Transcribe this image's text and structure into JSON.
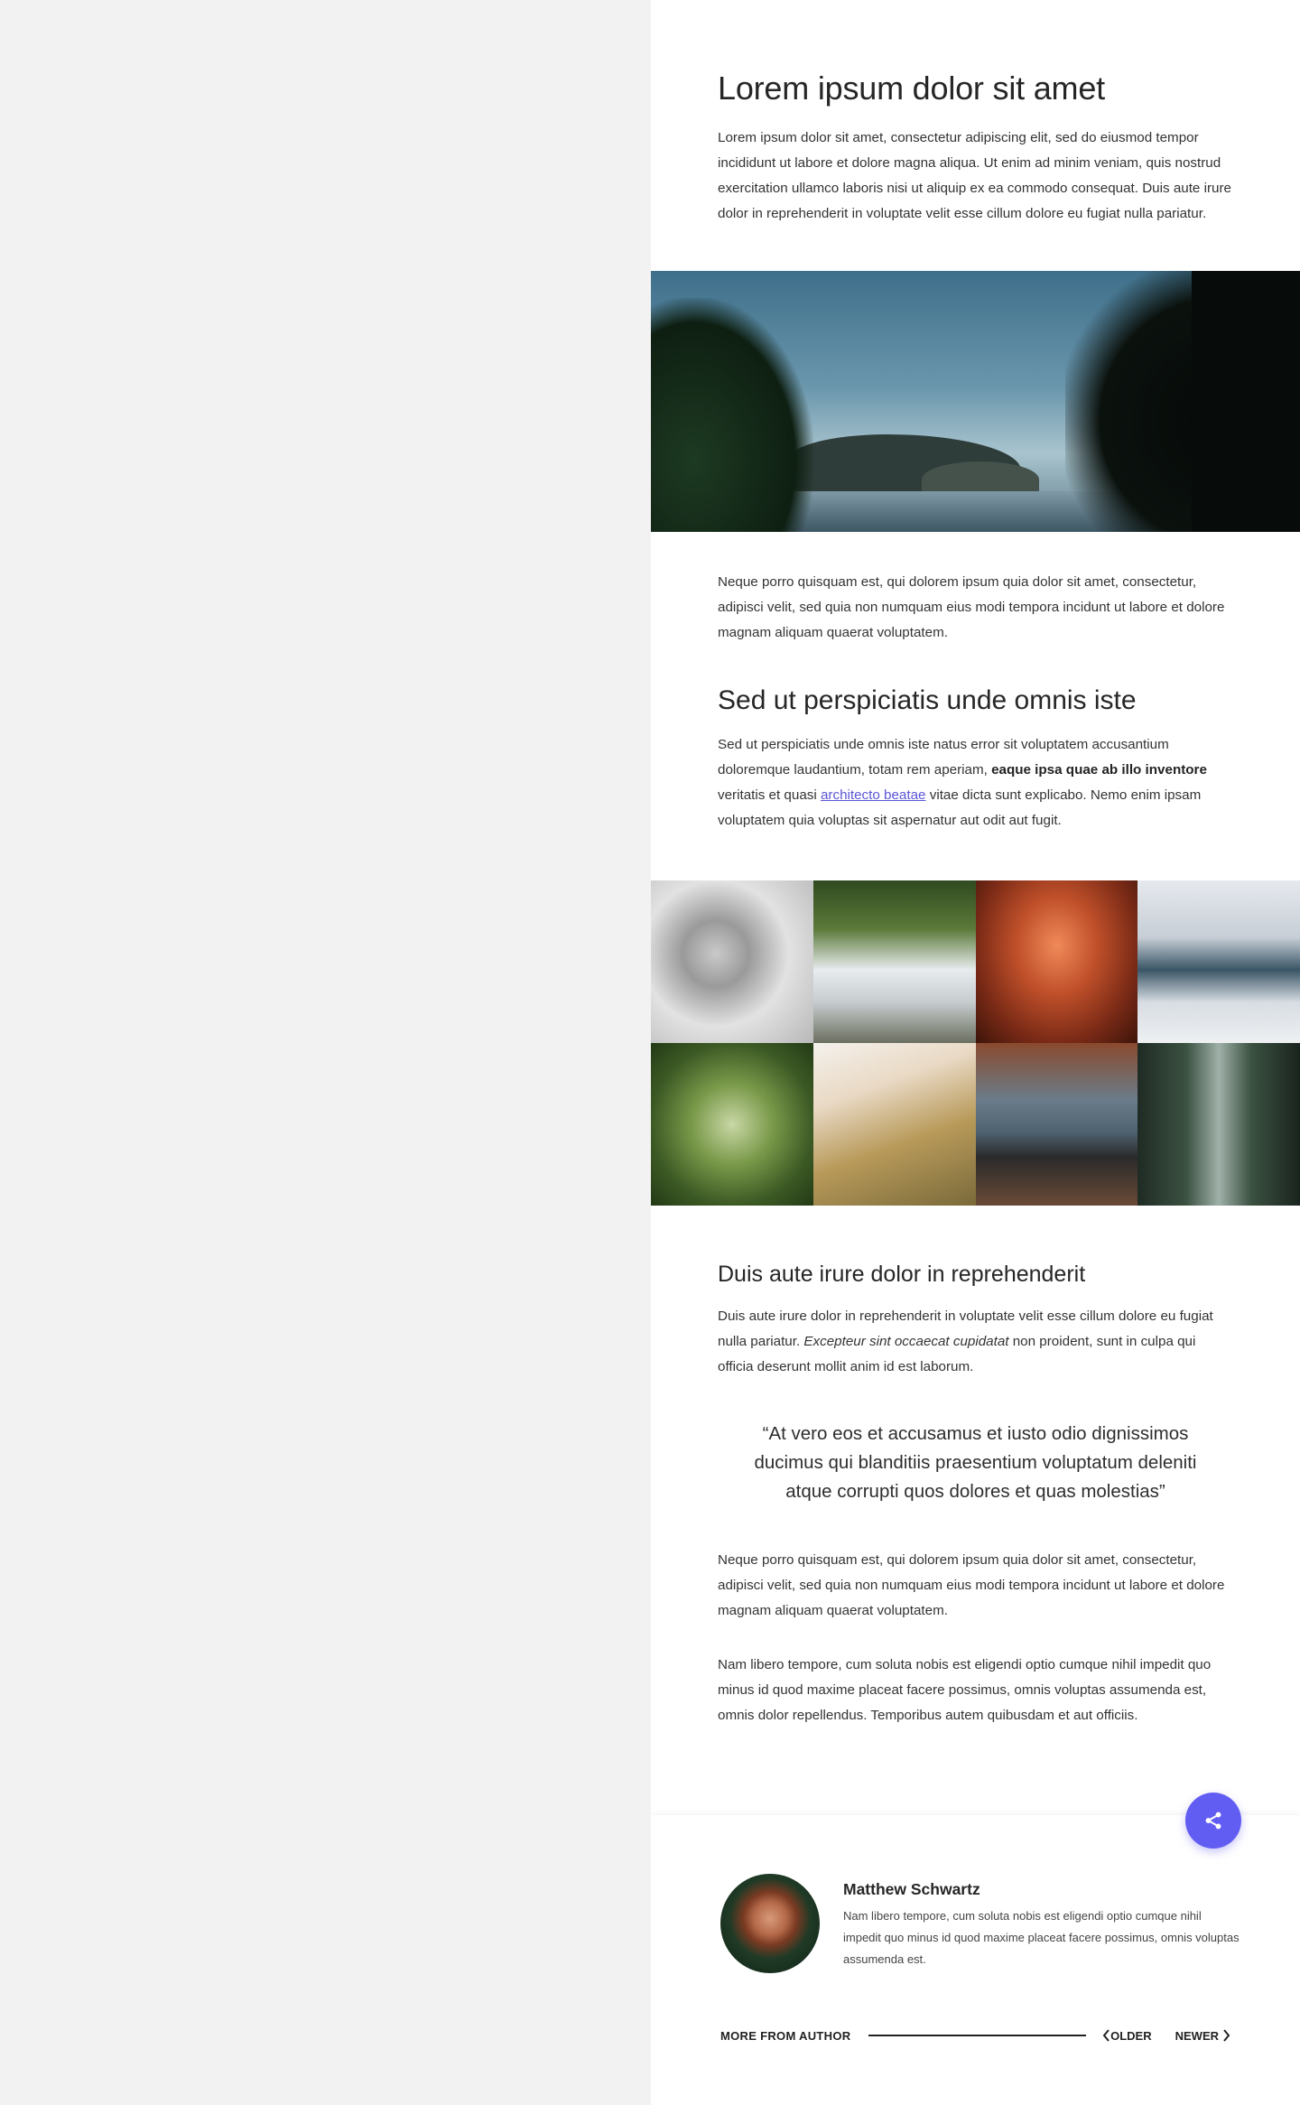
{
  "article": {
    "title": "Lorem ipsum dolor sit amet",
    "intro": "Lorem ipsum dolor sit amet, consectetur adipiscing elit, sed do eiusmod tempor incididunt ut labore et dolore magna aliqua. Ut enim ad minim veniam, quis nostrud exercitation ullamco laboris nisi ut aliquip ex ea commodo consequat. Duis aute irure dolor in reprehenderit in voluptate velit esse cillum dolore eu fugiat nulla pariatur.",
    "paragraph2": "Neque porro quisquam est, qui dolorem ipsum quia dolor sit amet, consectetur, adipisci velit, sed quia non numquam eius modi tempora incidunt ut labore et dolore magnam aliquam quaerat voluptatem.",
    "heading2": "Sed ut perspiciatis unde omnis iste",
    "p3_a": "Sed ut perspiciatis unde omnis iste natus error sit voluptatem accusantium doloremque laudantium, totam rem aperiam, ",
    "p3_bold": "eaque ipsa quae ab illo inventore",
    "p3_b": " veritatis et quasi ",
    "p3_link": "architecto beatae",
    "p3_c": " vitae dicta sunt explicabo. Nemo enim ipsam voluptatem quia voluptas sit aspernatur aut odit aut fugit.",
    "heading3": "Duis aute irure dolor in reprehenderit",
    "p4_a": "Duis aute irure dolor in reprehenderit in voluptate velit esse cillum dolore eu fugiat nulla pariatur. ",
    "p4_em": "Excepteur sint occaecat cupidatat",
    "p4_b": " non proident, sunt in culpa qui officia deserunt mollit anim id est laborum.",
    "quote": "“At vero eos et accusamus et iusto odio dignissimos ducimus qui blanditiis praesentium voluptatum deleniti atque corrupti quos dolores et quas molestias”",
    "paragraph5": "Neque porro quisquam est, qui dolorem ipsum quia dolor sit amet, consectetur, adipisci velit, sed quia non numquam eius modi tempora incidunt ut labore et dolore magnam aliquam quaerat voluptatem.",
    "paragraph6": "Nam libero tempore, cum soluta nobis est eligendi optio cumque nihil impedit quo minus id quod maxime placeat facere possimus, omnis voluptas assumenda est, omnis dolor repellendus. Temporibus autem quibusdam et aut officiis."
  },
  "hero_image": {
    "icon": "landscape-photo",
    "subject": "coastal cliffs framed by trees"
  },
  "gallery": [
    {
      "icon": "bird-photo"
    },
    {
      "icon": "waterfall-photo"
    },
    {
      "icon": "canyon-photo"
    },
    {
      "icon": "clouds-valley-photo"
    },
    {
      "icon": "succulent-photo"
    },
    {
      "icon": "path-photo"
    },
    {
      "icon": "people-lake-photo"
    },
    {
      "icon": "forest-waterfall-photo"
    }
  ],
  "author": {
    "name": "Matthew Schwartz",
    "bio": "Nam libero tempore, cum soluta nobis est eligendi optio cumque nihil impedit quo minus id quod maxime placeat facere possimus, omnis voluptas assumenda est.",
    "more_label": "MORE FROM AUTHOR",
    "older_label": "OLDER",
    "newer_label": "NEWER"
  },
  "share": {
    "icon": "share-icon"
  },
  "colors": {
    "accent": "#615df2",
    "link": "#5a56d8",
    "background": "#f2f2f2",
    "panel": "#ffffff"
  }
}
